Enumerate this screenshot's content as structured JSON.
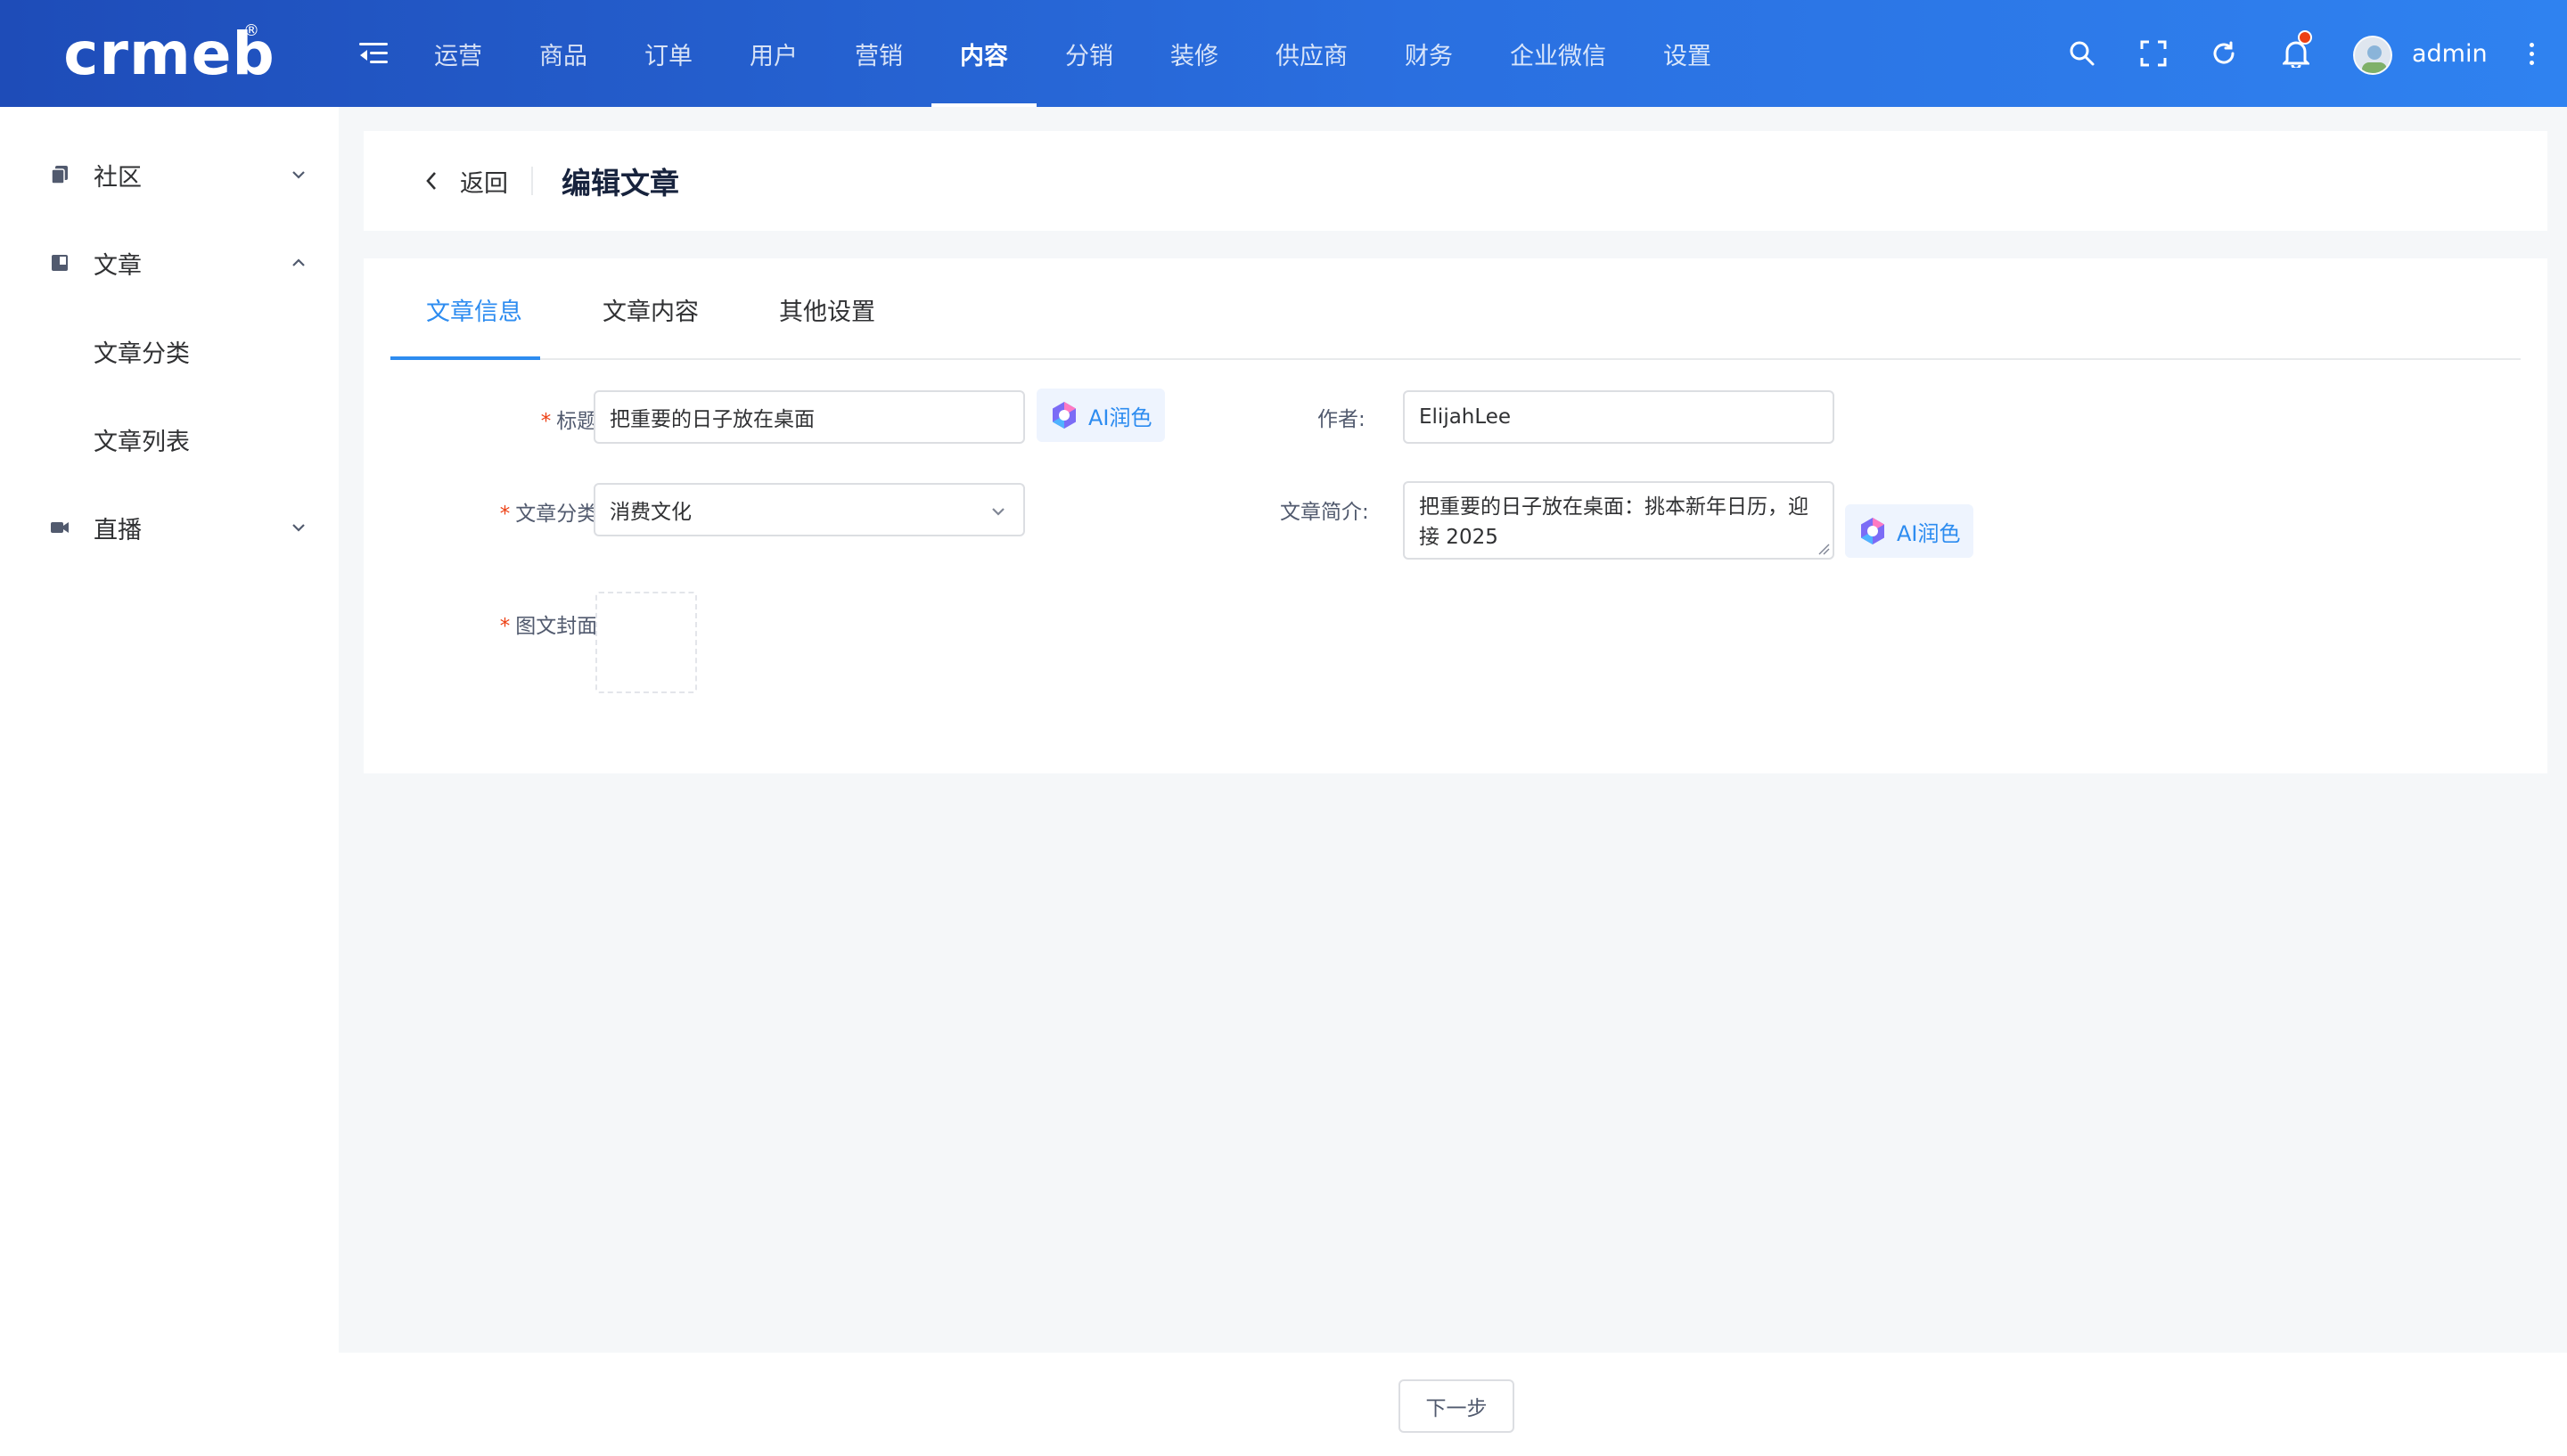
{
  "brand": {
    "logo_text": "crmeb",
    "reg_mark": "®"
  },
  "header": {
    "nav": [
      {
        "label": "运营",
        "active": false
      },
      {
        "label": "商品",
        "active": false
      },
      {
        "label": "订单",
        "active": false
      },
      {
        "label": "用户",
        "active": false
      },
      {
        "label": "营销",
        "active": false
      },
      {
        "label": "内容",
        "active": true
      },
      {
        "label": "分销",
        "active": false
      },
      {
        "label": "装修",
        "active": false
      },
      {
        "label": "供应商",
        "active": false
      },
      {
        "label": "财务",
        "active": false
      },
      {
        "label": "企业微信",
        "active": false
      },
      {
        "label": "设置",
        "active": false
      }
    ],
    "icons": [
      "search-icon",
      "fullscreen-icon",
      "refresh-icon",
      "bell-icon"
    ],
    "has_notification": true,
    "username": "admin"
  },
  "sidebar": {
    "items": [
      {
        "label": "社区",
        "icon": "copy-icon",
        "expanded": false
      },
      {
        "label": "文章",
        "icon": "book-icon",
        "expanded": true,
        "children": [
          {
            "label": "文章分类"
          },
          {
            "label": "文章列表"
          }
        ]
      },
      {
        "label": "直播",
        "icon": "video-camera-icon",
        "expanded": false
      }
    ]
  },
  "page": {
    "back_label": "返回",
    "title": "编辑文章"
  },
  "tabs": [
    {
      "label": "文章信息",
      "active": true
    },
    {
      "label": "文章内容",
      "active": false
    },
    {
      "label": "其他设置",
      "active": false
    }
  ],
  "form": {
    "title": {
      "label": "标题:",
      "required": true,
      "value": "把重要的日子放在桌面"
    },
    "author": {
      "label": "作者:",
      "required": false,
      "value": "ElijahLee"
    },
    "category": {
      "label": "文章分类:",
      "required": true,
      "value": "消费文化"
    },
    "summary": {
      "label": "文章简介:",
      "required": false,
      "value": "把重要的日子放在桌面：挑本新年日历，迎接 2025"
    },
    "cover": {
      "label": "图文封面:",
      "required": true
    },
    "ai_label": "AI润色"
  },
  "footer": {
    "next_label": "下一步"
  },
  "colors": {
    "header_start": "#1e4cb8",
    "header_end": "#2f82f0",
    "accent": "#2d8cf0",
    "required": "#ed4014",
    "badge": "#ed4014"
  }
}
